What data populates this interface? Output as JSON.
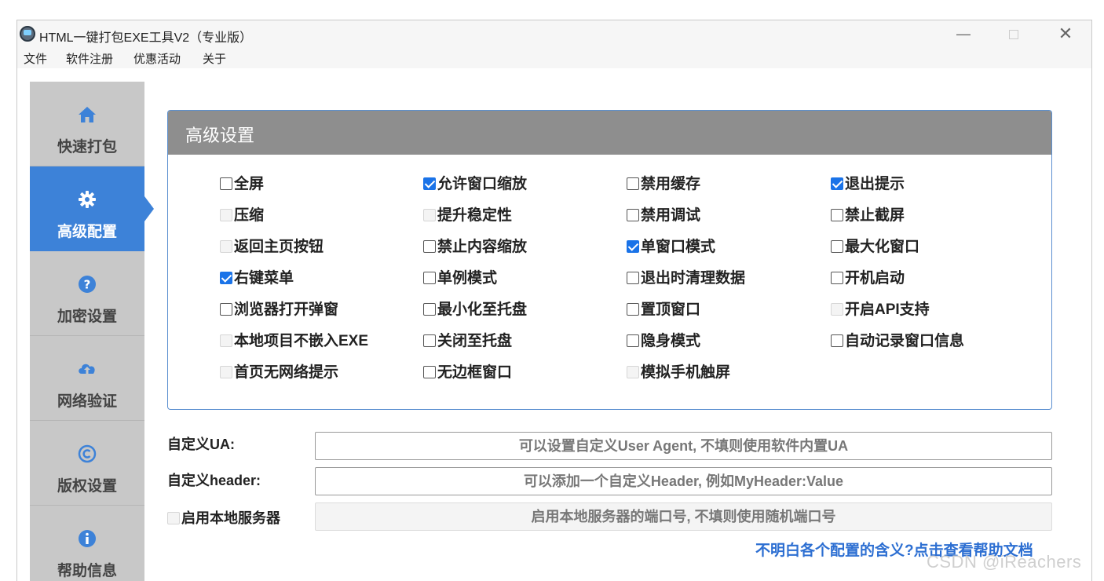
{
  "window": {
    "title": "HTML一键打包EXE工具V2（专业版）",
    "minimize_glyph": "—",
    "close_glyph": "✕"
  },
  "menu": [
    "文件",
    "软件注册",
    "优惠活动",
    "关于"
  ],
  "sidebar": {
    "items": [
      {
        "label": "快速打包",
        "icon": "home-icon",
        "active": false
      },
      {
        "label": "高级配置",
        "icon": "gear-icon",
        "active": true
      },
      {
        "label": "加密设置",
        "icon": "question-circle-icon",
        "active": false
      },
      {
        "label": "网络验证",
        "icon": "cloud-upload-icon",
        "active": false
      },
      {
        "label": "版权设置",
        "icon": "copyright-icon",
        "active": false
      },
      {
        "label": "帮助信息",
        "icon": "info-circle-icon",
        "active": false
      }
    ]
  },
  "panel": {
    "title": "高级设置",
    "options": [
      [
        {
          "label": "全屏",
          "state": "unchecked"
        },
        {
          "label": "压缩",
          "state": "disabled"
        },
        {
          "label": "返回主页按钮",
          "state": "disabled"
        },
        {
          "label": "右键菜单",
          "state": "checked"
        },
        {
          "label": "浏览器打开弹窗",
          "state": "unchecked"
        },
        {
          "label": "本地项目不嵌入EXE",
          "state": "disabled"
        },
        {
          "label": "首页无网络提示",
          "state": "disabled"
        }
      ],
      [
        {
          "label": "允许窗口缩放",
          "state": "checked"
        },
        {
          "label": "提升稳定性",
          "state": "disabled"
        },
        {
          "label": "禁止内容缩放",
          "state": "unchecked"
        },
        {
          "label": "单例模式",
          "state": "unchecked"
        },
        {
          "label": "最小化至托盘",
          "state": "unchecked"
        },
        {
          "label": "关闭至托盘",
          "state": "unchecked"
        },
        {
          "label": "无边框窗口",
          "state": "unchecked"
        }
      ],
      [
        {
          "label": "禁用缓存",
          "state": "unchecked"
        },
        {
          "label": "禁用调试",
          "state": "unchecked"
        },
        {
          "label": "单窗口模式",
          "state": "checked"
        },
        {
          "label": "退出时清理数据",
          "state": "unchecked"
        },
        {
          "label": "置顶窗口",
          "state": "unchecked"
        },
        {
          "label": "隐身模式",
          "state": "unchecked"
        },
        {
          "label": "模拟手机触屏",
          "state": "disabled"
        }
      ],
      [
        {
          "label": "退出提示",
          "state": "checked"
        },
        {
          "label": "禁止截屏",
          "state": "unchecked"
        },
        {
          "label": "最大化窗口",
          "state": "unchecked"
        },
        {
          "label": "开机启动",
          "state": "unchecked"
        },
        {
          "label": "开启API支持",
          "state": "disabled"
        },
        {
          "label": "自动记录窗口信息",
          "state": "unchecked"
        }
      ]
    ]
  },
  "form": {
    "ua_label": "自定义UA:",
    "ua_placeholder": "可以设置自定义User Agent, 不填则使用软件内置UA",
    "header_label": "自定义header:",
    "header_placeholder": "可以添加一个自定义Header, 例如MyHeader:Value",
    "server_label": "启用本地服务器",
    "server_placeholder": "启用本地服务器的端口号, 不填则使用随机端口号",
    "server_enabled": false
  },
  "help_link": "不明白各个配置的含义?点击查看帮助文档",
  "watermark": "CSDN @iReachers",
  "colors": {
    "accent": "#3d82d8",
    "sidebar_bg": "#c8c8c8",
    "panel_header": "#8e8e8e",
    "link": "#2d6fd2"
  }
}
